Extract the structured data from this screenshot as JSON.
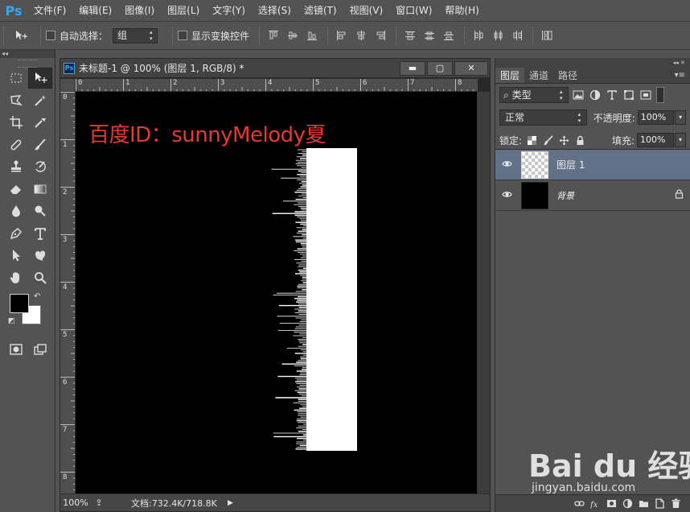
{
  "app": {
    "logo": "Ps"
  },
  "menu": [
    "文件(F)",
    "编辑(E)",
    "图像(I)",
    "图层(L)",
    "文字(Y)",
    "选择(S)",
    "滤镜(T)",
    "视图(V)",
    "窗口(W)",
    "帮助(H)"
  ],
  "options": {
    "auto_select_label": "自动选择：",
    "auto_select_value": "组",
    "show_transform_label": "显示变换控件"
  },
  "document": {
    "title": "未标题-1 @ 100% (图层 1, RGB/8) *",
    "ruler_h": [
      "0",
      "1",
      "2",
      "3",
      "4",
      "5",
      "6",
      "7",
      "8"
    ],
    "ruler_v": [
      "0",
      "1",
      "2",
      "3",
      "4",
      "5",
      "6",
      "7",
      "8"
    ],
    "canvas_text": "百度ID：sunnyMelody夏",
    "zoom": "100%",
    "doc_size": "文档:732.4K/718.8K"
  },
  "layers_panel": {
    "tabs": [
      "图层",
      "通道",
      "路径"
    ],
    "filter_type": "类型",
    "blend_mode": "正常",
    "opacity_label": "不透明度:",
    "opacity_value": "100%",
    "lock_label": "锁定:",
    "fill_label": "填充:",
    "fill_value": "100%",
    "layers": [
      {
        "name": "图层 1",
        "selected": true,
        "thumb": "transparent"
      },
      {
        "name": "背景",
        "selected": false,
        "thumb": "black",
        "locked": true
      }
    ]
  },
  "watermark": {
    "logo": "Bai du 经验",
    "url": "jingyan.baidu.com"
  },
  "colors": {
    "ps_blue": "#31a8ff",
    "canvas_text": "#e53935",
    "selected_layer": "#627088"
  }
}
